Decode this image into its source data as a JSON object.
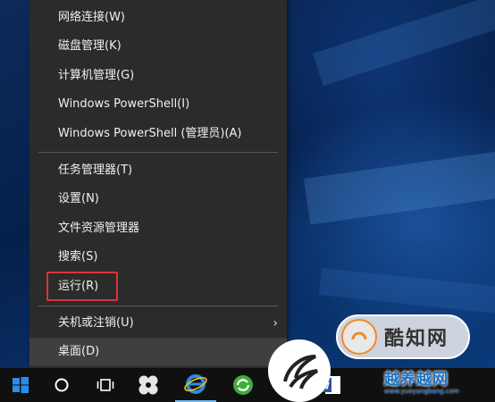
{
  "menu": {
    "items": [
      {
        "label": "网络连接(W)"
      },
      {
        "label": "磁盘管理(K)"
      },
      {
        "label": "计算机管理(G)"
      },
      {
        "label": "Windows PowerShell(I)"
      },
      {
        "label": "Windows PowerShell (管理员)(A)"
      },
      {
        "label": "任务管理器(T)"
      },
      {
        "label": "设置(N)"
      },
      {
        "label": "文件资源管理器"
      },
      {
        "label": "搜索(S)"
      },
      {
        "label": "运行(R)"
      },
      {
        "label": "关机或注销(U)",
        "has_submenu": true
      },
      {
        "label": "桌面(D)",
        "hovered": true
      }
    ],
    "highlighted_item": "运行(R)"
  },
  "taskbar": {
    "start_icon": "windows-logo-icon",
    "search_icon": "cortana-circle-icon",
    "taskview_icon": "task-view-icon",
    "apps": [
      {
        "icon": "fan-app-icon"
      },
      {
        "icon": "internet-explorer-icon",
        "active": true
      },
      {
        "icon": "green-refresh-app-icon"
      },
      {
        "icon": "green-app-icon"
      },
      {
        "icon": "word-icon"
      }
    ]
  },
  "watermarks": {
    "badge_text": "酷知网",
    "site_name": "越养越网",
    "site_url": "www.yueyangbang.com"
  },
  "colors": {
    "menu_bg": "#2b2b2b",
    "highlight_border": "#d9343a",
    "taskbar_bg": "#101010",
    "accent": "#76b9ed"
  }
}
